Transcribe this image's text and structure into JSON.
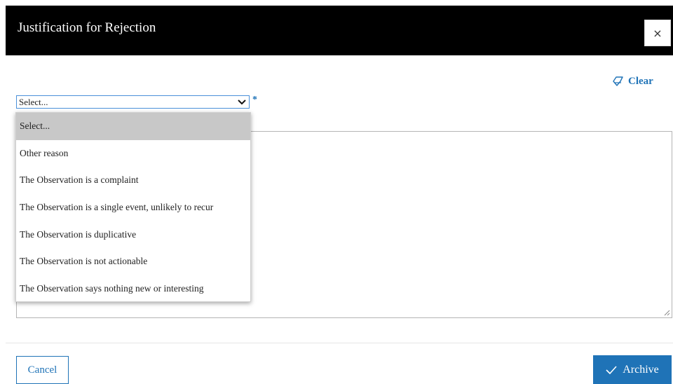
{
  "dialog": {
    "title": "Justification for Rejection",
    "close_label": "×"
  },
  "clear": {
    "label": "Clear",
    "icon": "eraser-icon"
  },
  "reason_select": {
    "value": "Select...",
    "required_marker": "*",
    "options": [
      "Select...",
      "Other reason",
      "The Observation is a complaint",
      "The Observation is a single event, unlikely to recur",
      "The Observation is duplicative",
      "The Observation is not actionable",
      "The Observation says nothing new or interesting"
    ],
    "highlighted_index": 0
  },
  "footer": {
    "cancel_label": "Cancel",
    "archive_label": "Archive",
    "archive_icon": "check-icon"
  },
  "colors": {
    "header_bg": "#000000",
    "accent": "#1f73b7",
    "option_highlight": "#c8c8c8"
  }
}
